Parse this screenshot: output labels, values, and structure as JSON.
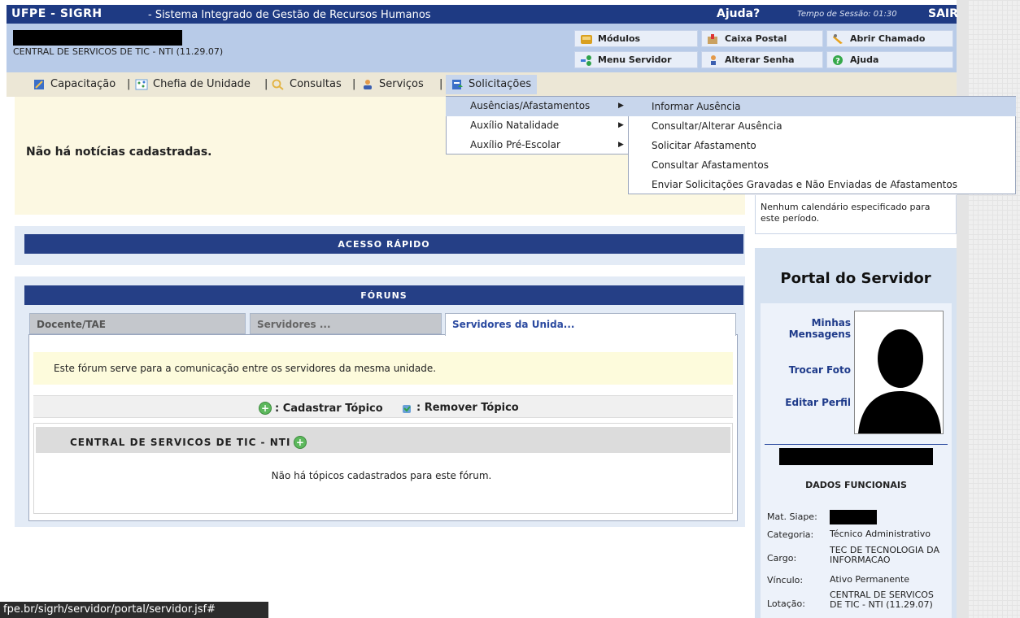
{
  "topbar": {
    "brand": "UFPE - SIGRH",
    "system_name": "- Sistema Integrado de Gestão de Recursos Humanos",
    "help": "Ajuda?",
    "session": "Tempo de Sessão: 01:30",
    "logout": "SAIR"
  },
  "header": {
    "unit": "CENTRAL DE SERVICOS DE TIC - NTI (11.29.07)",
    "buttons": {
      "modulos": "Módulos",
      "caixa_postal": "Caixa Postal",
      "abrir_chamado": "Abrir Chamado",
      "menu_servidor": "Menu Servidor",
      "alterar_senha": "Alterar Senha",
      "ajuda": "Ajuda"
    }
  },
  "menu": {
    "items": [
      "Capacitação",
      "Chefia de Unidade",
      "Consultas",
      "Serviços",
      "Solicitações"
    ],
    "separator": "|"
  },
  "dropdown": {
    "items": [
      "Ausências/Afastamentos",
      "Auxílio Natalidade",
      "Auxílio Pré-Escolar"
    ],
    "submenu": [
      "Informar Ausência",
      "Consultar/Alterar Ausência",
      "Solicitar Afastamento",
      "Consultar Afastamentos",
      "Enviar Solicitações Gravadas e Não Enviadas de Afastamentos"
    ]
  },
  "news": {
    "empty": "Não há notícias cadastradas."
  },
  "calendar": {
    "empty": "Nenhum calendário especificado para este período."
  },
  "quick_access": {
    "title": "Acesso Rápido"
  },
  "forums": {
    "title": "Fóruns",
    "tabs": [
      "Docente/TAE",
      "Servidores ...",
      "Servidores da Unida..."
    ],
    "description": "Este fórum serve para a comunicação entre os servidores da mesma unidade.",
    "add_topic": ": Cadastrar Tópico",
    "remove_topic": ": Remover Tópico",
    "unit_title": "CENTRAL DE SERVICOS DE TIC - NTI",
    "no_topics": "Não há tópicos cadastrados para este fórum."
  },
  "portal": {
    "title": "Portal do Servidor",
    "links": [
      "Minhas Mensagens",
      "Trocar Foto",
      "Editar Perfil"
    ],
    "dados_title": "DADOS FUNCIONAIS",
    "fields": [
      {
        "label": "Mat. Siape:",
        "value": ""
      },
      {
        "label": "Categoria:",
        "value": "Técnico Administrativo"
      },
      {
        "label": "Cargo:",
        "value": "TEC DE TECNOLOGIA DA INFORMACAO"
      },
      {
        "label": "Vínculo:",
        "value": "Ativo Permanente"
      },
      {
        "label": "Lotação:",
        "value": "CENTRAL DE SERVICOS DE TIC - NTI (11.29.07)"
      }
    ]
  },
  "statusbar": {
    "url": "fpe.br/sigrh/servidor/portal/servidor.jsf#"
  },
  "colors": {
    "topbar": "#1e3a83",
    "header": "#b8cbe8",
    "menubar": "#ece7d6",
    "section_header": "#253f86",
    "highlight": "#c8d6ec"
  },
  "icons": [
    "modulos-icon",
    "mail-icon",
    "ticket-icon",
    "menu-icon",
    "key-icon",
    "help-icon",
    "book-icon",
    "chart-icon",
    "search-icon",
    "user-icon",
    "form-icon",
    "add-icon",
    "trash-icon",
    "avatar-silhouette"
  ]
}
